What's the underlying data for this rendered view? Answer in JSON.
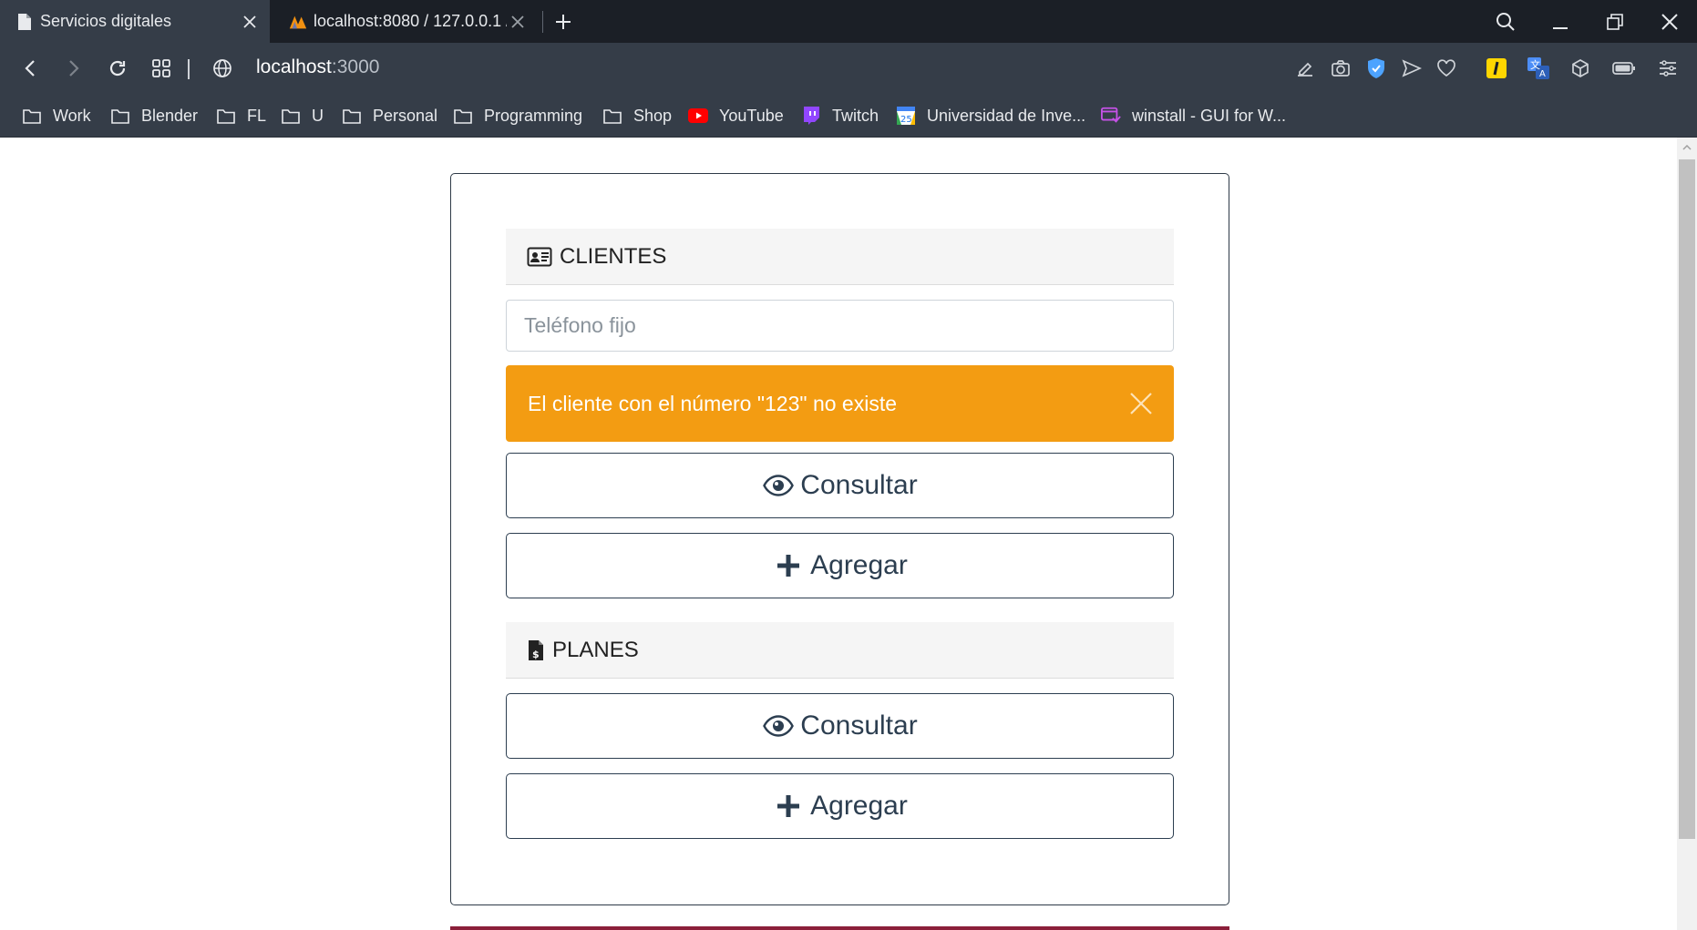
{
  "browser": {
    "tabs": [
      {
        "title": "Servicios digitales",
        "icon": "document-icon",
        "active": true
      },
      {
        "title": "localhost:8080 / 127.0.0.1 /",
        "icon": "phpmyadmin-icon",
        "active": false
      }
    ],
    "url_host": "localhost",
    "url_port": ":3000",
    "bookmarks": [
      {
        "label": "Work",
        "icon": "folder-icon"
      },
      {
        "label": "Blender",
        "icon": "folder-icon"
      },
      {
        "label": "FL",
        "icon": "folder-icon"
      },
      {
        "label": "U",
        "icon": "folder-icon"
      },
      {
        "label": "Personal",
        "icon": "folder-icon"
      },
      {
        "label": "Programming",
        "icon": "folder-icon"
      },
      {
        "label": "Shop",
        "icon": "folder-icon"
      },
      {
        "label": "YouTube",
        "icon": "youtube-icon"
      },
      {
        "label": "Twitch",
        "icon": "twitch-icon"
      },
      {
        "label": "Universidad de Inve...",
        "icon": "calendar-icon"
      },
      {
        "label": "winstall - GUI for W...",
        "icon": "winstall-icon"
      }
    ]
  },
  "page": {
    "clientes": {
      "header": "CLIENTES",
      "phone_placeholder": "Teléfono fijo",
      "phone_value": "",
      "alert_text": "El cliente con el número \"123\" no existe",
      "consult_label": "Consultar",
      "add_label": "Agregar"
    },
    "planes": {
      "header": "PLANES",
      "consult_label": "Consultar",
      "add_label": "Agregar"
    }
  },
  "colors": {
    "alert_warning": "#f39c12",
    "button_text": "#2c3e50",
    "chrome_dark": "#1b1f26",
    "chrome_toolbar": "#353d48"
  }
}
